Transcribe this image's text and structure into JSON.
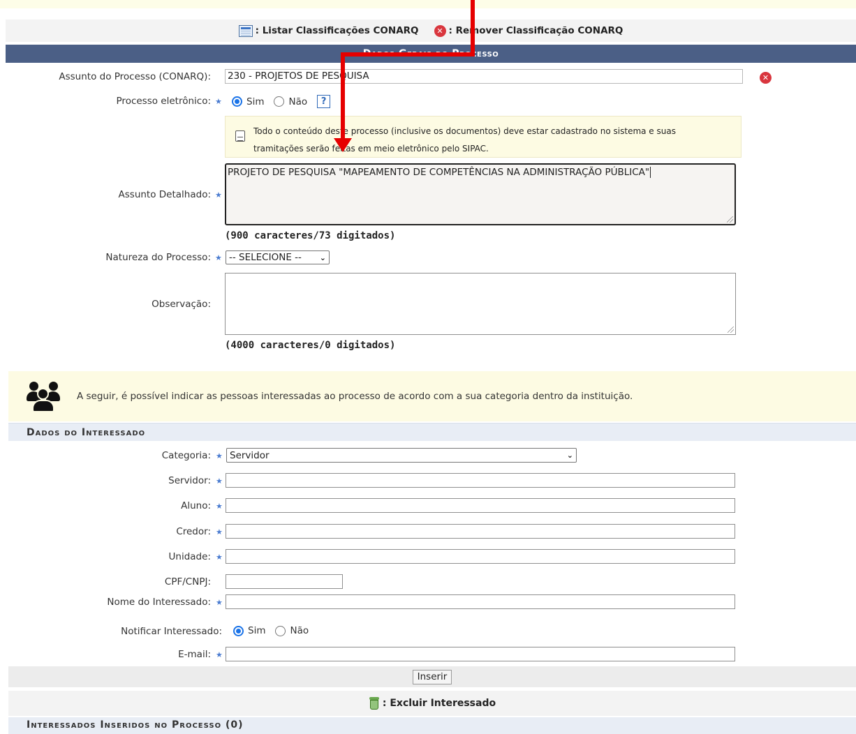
{
  "legend": {
    "list_label": ": Listar Classificações CONARQ",
    "remove_label": ": Remover Classificação CONARQ"
  },
  "section_title": "Dados Gerais do Processo",
  "form": {
    "assunto_label": "Assunto do Processo (CONARQ):",
    "assunto_value": "230 - PROJETOS DE PESQUISA",
    "eletronico_label": "Processo eletrônico:",
    "radio_sim": "Sim",
    "radio_nao": "Não",
    "help": "?",
    "info_line1": "Todo o conteúdo deste processo (inclusive os documentos) deve estar cadastrado no sistema e suas",
    "info_line2": "tramitações serão feitas em meio eletrônico pelo SIPAC.",
    "detalhado_label": "Assunto Detalhado:",
    "detalhado_value": "PROJETO DE PESQUISA \"MAPEAMENTO DE COMPETÊNCIAS NA ADMINISTRAÇÃO PÚBLICA\"",
    "detalhado_counter": "(900 caracteres/73 digitados)",
    "natureza_label": "Natureza do Processo:",
    "natureza_value": "-- SELECIONE --",
    "observacao_label": "Observação:",
    "observacao_counter": "(4000 caracteres/0 digitados)"
  },
  "people_notice": "A seguir, é possível indicar as pessoas interessadas ao processo de acordo com a sua categoria dentro da instituição.",
  "interessado": {
    "title": "Dados do Interessado",
    "categoria_label": "Categoria:",
    "categoria_value": "Servidor",
    "servidor_label": "Servidor:",
    "aluno_label": "Aluno:",
    "credor_label": "Credor:",
    "unidade_label": "Unidade:",
    "cpf_label": "CPF/CNPJ:",
    "nome_label": "Nome do Interessado:",
    "notificar_label": "Notificar Interessado:",
    "notificar_sim": "Sim",
    "notificar_nao": "Não",
    "email_label": "E-mail:",
    "inserir_button": "Inserir"
  },
  "excluir_label": ": Excluir Interessado",
  "inseridos_title": "Interessados Inseridos no Processo (0)",
  "colors": {
    "header_bg": "#4b5f86",
    "arrow": "#e60000",
    "notice_bg": "#fdfbe3"
  }
}
